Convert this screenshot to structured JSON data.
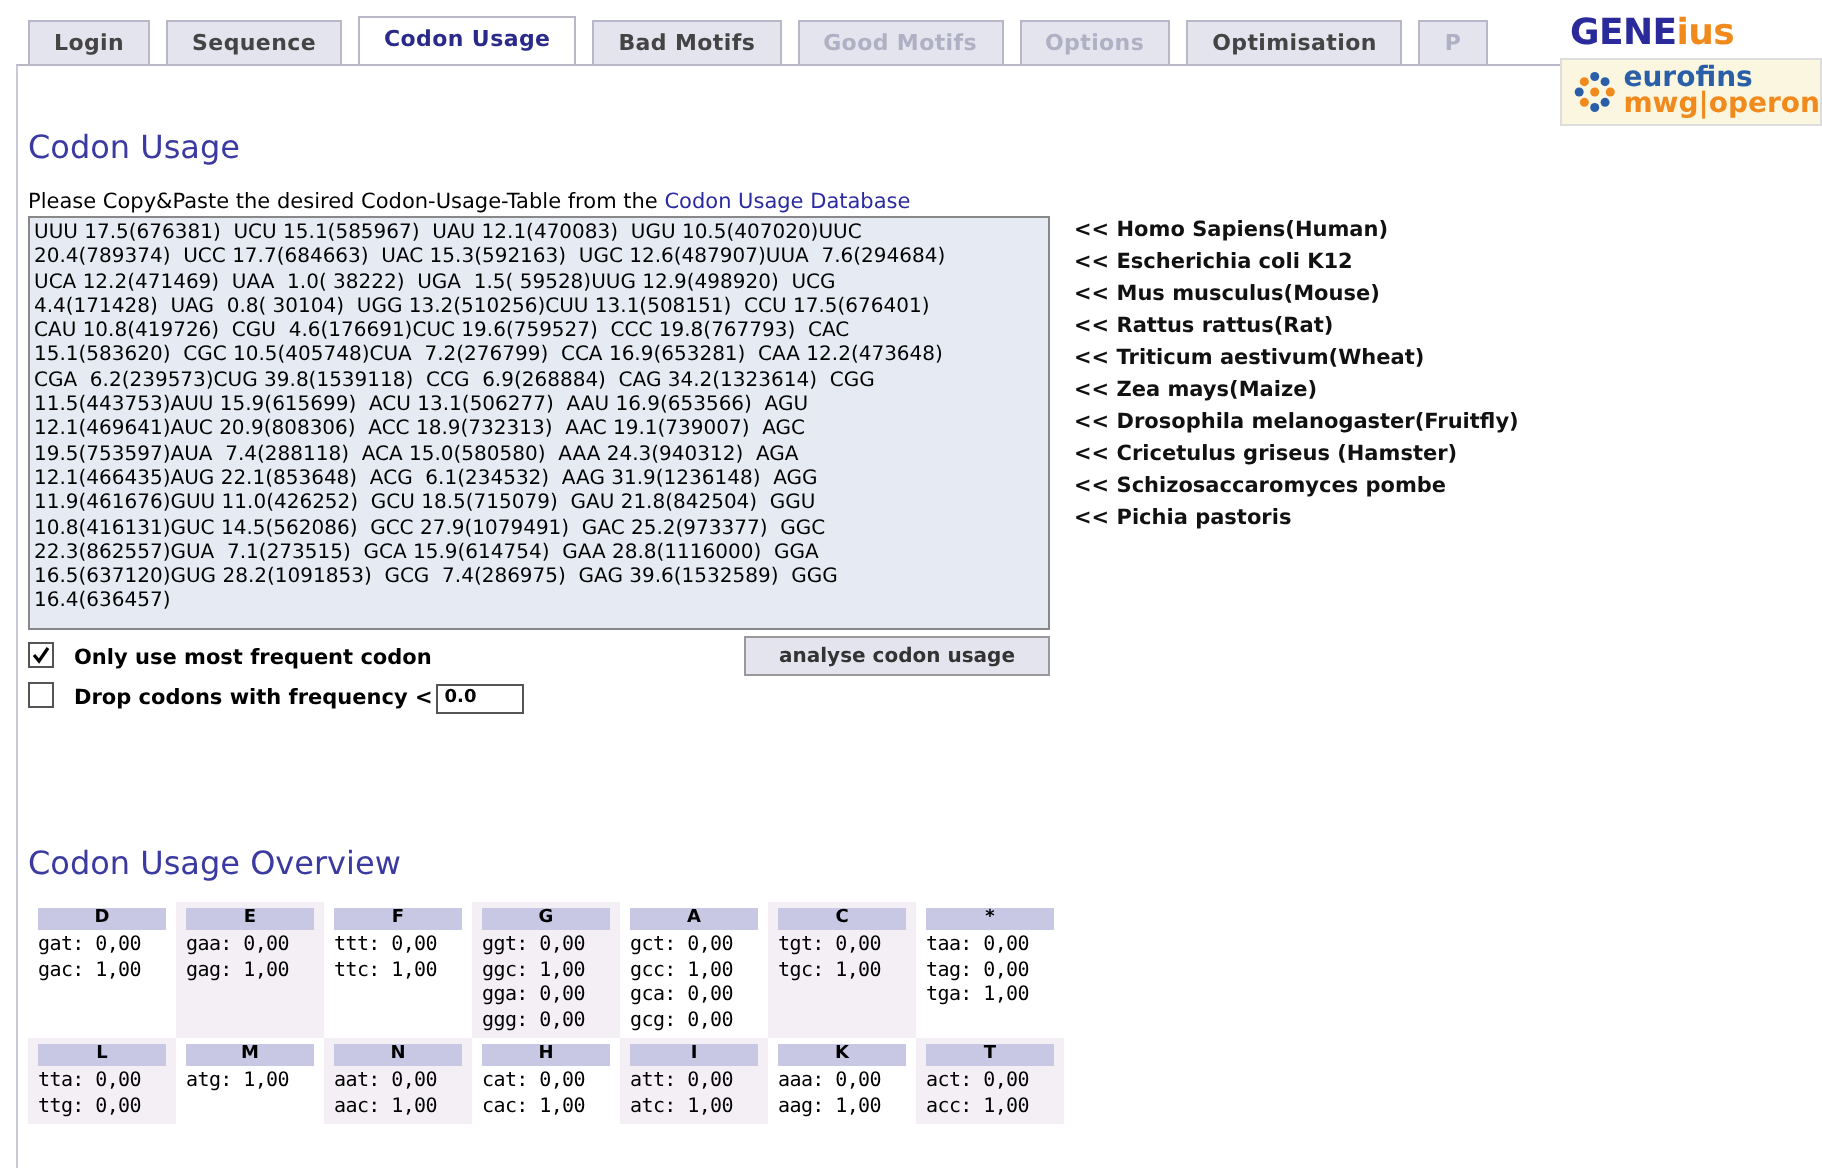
{
  "tabs": [
    {
      "label": "Login",
      "selected": false,
      "disabled": false
    },
    {
      "label": "Sequence",
      "selected": false,
      "disabled": false
    },
    {
      "label": "Codon Usage",
      "selected": true,
      "disabled": false
    },
    {
      "label": "Bad Motifs",
      "selected": false,
      "disabled": false
    },
    {
      "label": "Good Motifs",
      "selected": false,
      "disabled": true
    },
    {
      "label": "Options",
      "selected": false,
      "disabled": true
    },
    {
      "label": "Optimisation",
      "selected": false,
      "disabled": false
    },
    {
      "label": "P",
      "selected": false,
      "disabled": true
    }
  ],
  "logo": {
    "name": "GENE",
    "suffix": "ius",
    "company": "eurofins",
    "division": "mwg|operon"
  },
  "heading": "Codon Usage",
  "instruction": {
    "text": "Please Copy&Paste the desired Codon-Usage-Table from the",
    "link": "Codon Usage Database"
  },
  "codon_table": {
    "lines": [
      "UUU 17.5(676381)  UCU 15.1(585967)  UAU 12.1(470083)  UGU 10.5(407020)UUC",
      "20.4(789374)  UCC 17.7(684663)  UAC 15.3(592163)  UGC 12.6(487907)UUA  7.6(294684)",
      "UCA 12.2(471469)  UAA  1.0( 38222)  UGA  1.5( 59528)UUG 12.9(498920)  UCG",
      "4.4(171428)  UAG  0.8( 30104)  UGG 13.2(510256)CUU 13.1(508151)  CCU 17.5(676401)",
      "CAU 10.8(419726)  CGU  4.6(176691)CUC 19.6(759527)  CCC 19.8(767793)  CAC",
      "15.1(583620)  CGC 10.5(405748)CUA  7.2(276799)  CCA 16.9(653281)  CAA 12.2(473648)",
      "CGA  6.2(239573)CUG 39.8(1539118)  CCG  6.9(268884)  CAG 34.2(1323614)  CGG",
      "11.5(443753)AUU 15.9(615699)  ACU 13.1(506277)  AAU 16.9(653566)  AGU",
      "12.1(469641)AUC 20.9(808306)  ACC 18.9(732313)  AAC 19.1(739007)  AGC",
      "19.5(753597)AUA  7.4(288118)  ACA 15.0(580580)  AAA 24.3(940312)  AGA",
      "12.1(466435)AUG 22.1(853648)  ACG  6.1(234532)  AAG 31.9(1236148)  AGG",
      "11.9(461676)GUU 11.0(426252)  GCU 18.5(715079)  GAU 21.8(842504)  GGU",
      "10.8(416131)GUC 14.5(562086)  GCC 27.9(1079491)  GAC 25.2(973377)  GGC",
      "22.3(862557)GUA  7.1(273515)  GCA 15.9(614754)  GAA 28.8(1116000)  GGA",
      "16.5(637120)GUG 28.2(1091853)  GCG  7.4(286975)  GAG 39.6(1532589)  GGG",
      "16.4(636457)"
    ]
  },
  "organisms": [
    "<< Homo Sapiens(Human)",
    "<< Escherichia coli K12",
    "<< Mus musculus(Mouse)",
    "<< Rattus rattus(Rat)",
    "<< Triticum aestivum(Wheat)",
    "<< Zea mays(Maize)",
    "<< Drosophila melanogaster(Fruitfly)",
    "<< Cricetulus griseus (Hamster)",
    "<< Schizosaccaromyces pombe",
    "<< Pichia pastoris"
  ],
  "options": [
    {
      "kind": "checkbox",
      "label": "Only use most frequent codon",
      "checked": true
    },
    {
      "kind": "threshold",
      "label": "Drop codons with frequency <",
      "checked": false,
      "value": "0.0"
    }
  ],
  "analyse_button": "analyse codon usage",
  "overview_heading": "Codon Usage Overview",
  "overview": [
    [
      {
        "aa": "D",
        "codons": [
          "gat: 0,00",
          "gac: 1,00"
        ]
      },
      {
        "aa": "E",
        "codons": [
          "gaa: 0,00",
          "gag: 1,00"
        ]
      },
      {
        "aa": "F",
        "codons": [
          "ttt: 0,00",
          "ttc: 1,00"
        ]
      },
      {
        "aa": "G",
        "codons": [
          "ggt: 0,00",
          "ggc: 1,00",
          "gga: 0,00",
          "ggg: 0,00"
        ]
      },
      {
        "aa": "A",
        "codons": [
          "gct: 0,00",
          "gcc: 1,00",
          "gca: 0,00",
          "gcg: 0,00"
        ]
      },
      {
        "aa": "C",
        "codons": [
          "tgt: 0,00",
          "tgc: 1,00"
        ]
      },
      {
        "aa": "*",
        "codons": [
          "taa: 0,00",
          "tag: 0,00",
          "tga: 1,00"
        ]
      }
    ],
    [
      {
        "aa": "L",
        "codons": [
          "tta: 0,00",
          "ttg: 0,00"
        ]
      },
      {
        "aa": "M",
        "codons": [
          "atg: 1,00"
        ]
      },
      {
        "aa": "N",
        "codons": [
          "aat: 0,00",
          "aac: 1,00"
        ]
      },
      {
        "aa": "H",
        "codons": [
          "cat: 0,00",
          "cac: 1,00"
        ]
      },
      {
        "aa": "I",
        "codons": [
          "att: 0,00",
          "atc: 1,00"
        ]
      },
      {
        "aa": "K",
        "codons": [
          "aaa: 0,00",
          "aag: 1,00"
        ]
      },
      {
        "aa": "T",
        "codons": [
          "act: 0,00",
          "acc: 1,00"
        ]
      }
    ]
  ]
}
